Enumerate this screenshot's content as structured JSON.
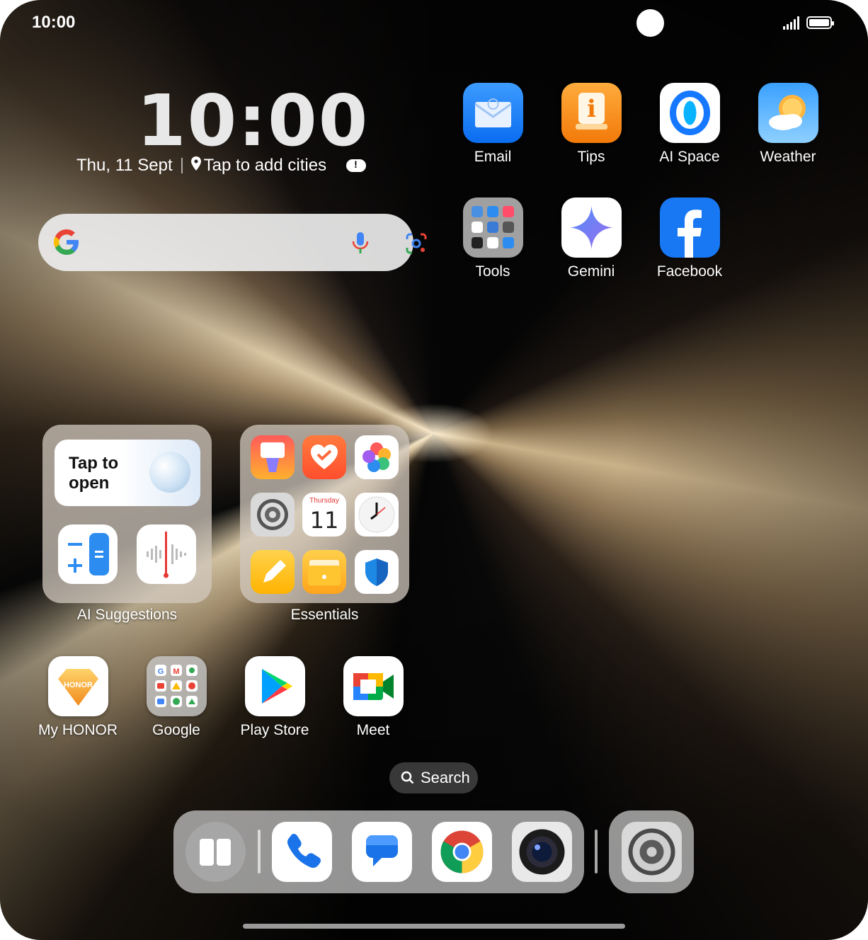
{
  "status_bar": {
    "time": "10:00",
    "signal_icon": "signal-icon",
    "battery_icon": "battery-icon"
  },
  "clock_widget": {
    "time": "10:00",
    "date": "Thu, 11 Sept",
    "city_prompt": "Tap to add cities",
    "location_icon": "location-pin-icon",
    "weather_icon": "weather-alert-icon"
  },
  "search_widget": {
    "logo": "google-g-icon",
    "mic_icon": "mic-icon",
    "lens_icon": "google-lens-icon"
  },
  "apps_top": [
    {
      "label": "Email",
      "icon": "email-icon"
    },
    {
      "label": "Tips",
      "icon": "tips-icon"
    },
    {
      "label": "AI Space",
      "icon": "ai-space-icon"
    },
    {
      "label": "Weather",
      "icon": "weather-icon"
    }
  ],
  "apps_second": [
    {
      "label": "Tools",
      "icon": "tools-folder-icon"
    },
    {
      "label": "Gemini",
      "icon": "gemini-icon"
    },
    {
      "label": "Facebook",
      "icon": "facebook-icon"
    }
  ],
  "ai_suggestions": {
    "label": "AI Suggestions",
    "card_text_line1": "Tap to",
    "card_text_line2": "open",
    "items": [
      "calculator-icon",
      "voice-recorder-icon"
    ]
  },
  "essentials": {
    "label": "Essentials",
    "calendar_day": "Thursday",
    "calendar_date": "11",
    "items": [
      "themes-icon",
      "health-icon",
      "gallery-icon",
      "settings-icon",
      "calendar-icon",
      "clock-icon",
      "notes-icon",
      "files-icon",
      "security-icon"
    ]
  },
  "apps_bottom": [
    {
      "label": "My HONOR",
      "icon": "my-honor-icon",
      "brand": "HONOR"
    },
    {
      "label": "Google",
      "icon": "google-folder-icon"
    },
    {
      "label": "Play Store",
      "icon": "play-store-icon"
    },
    {
      "label": "Meet",
      "icon": "meet-icon"
    }
  ],
  "app_search": {
    "label": "Search",
    "icon": "search-icon"
  },
  "dock": {
    "items": [
      "split-view-icon",
      "phone-icon",
      "messages-icon",
      "chrome-icon",
      "camera-icon"
    ],
    "recent": "settings-icon"
  },
  "colors": {
    "accent_blue": "#1a73e8",
    "tips_orange": "#f7931e",
    "facebook_blue": "#1877f2"
  }
}
